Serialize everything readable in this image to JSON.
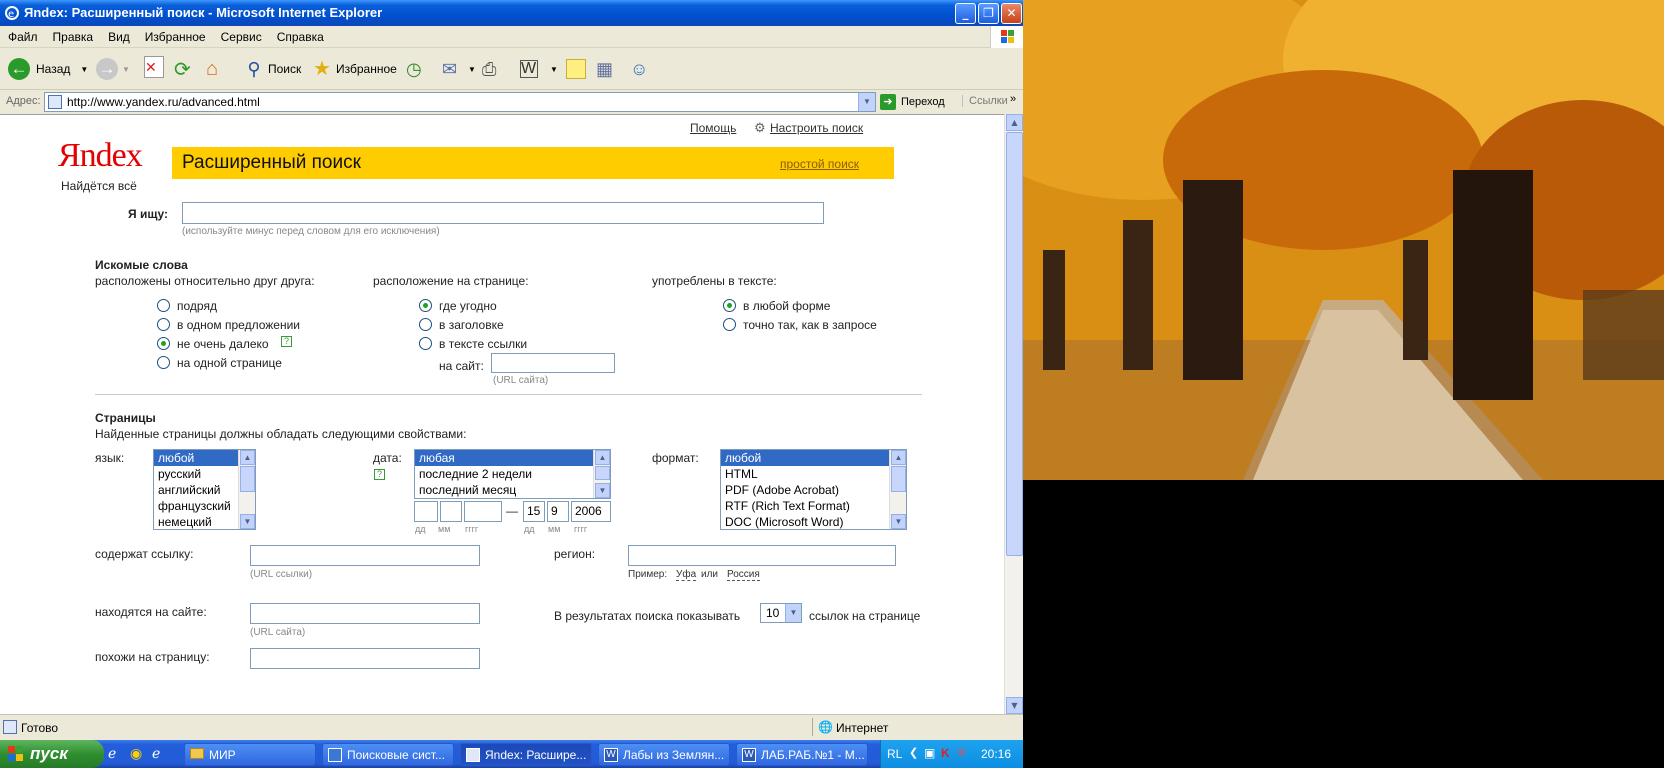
{
  "window": {
    "title": "Яndex: Расширенный поиск - Microsoft Internet Explorer",
    "min": "_",
    "max": "❐",
    "close": "✕"
  },
  "menu": [
    "Файл",
    "Правка",
    "Вид",
    "Избранное",
    "Сервис",
    "Справка"
  ],
  "toolbar": {
    "back": "Назад",
    "search": "Поиск",
    "favorites": "Избранное"
  },
  "address": {
    "label": "Адрес:",
    "url": "http://www.yandex.ru/advanced.html",
    "go": "Переход",
    "links": "Ссылки"
  },
  "page": {
    "logo": "Яndex",
    "slogan": "Найдётся всё",
    "help_link": "Помощь",
    "settings_link": "Настроить поиск",
    "header_title": "Расширенный поиск",
    "simple_search_link": "простой поиск",
    "query_label": "Я ищу:",
    "query_hint": "(используйте минус перед словом для его исключения)",
    "words_section": "Искомые слова",
    "relative_label": "расположены относительно друг друга:",
    "relative_options": [
      "подряд",
      "в одном предложении",
      "не очень далеко",
      "на одной странице"
    ],
    "position_label": "расположение на странице:",
    "position_options": [
      "где угодно",
      "в заголовке",
      "в тексте ссылки"
    ],
    "site_label": "на сайт:",
    "site_hint": "(URL сайта)",
    "form_label": "употреблены в тексте:",
    "form_options": [
      "в любой форме",
      "точно так, как в запросе"
    ],
    "pages_section": "Страницы",
    "pages_desc": "Найденные страницы должны обладать следующими свойствами:",
    "lang_label": "язык:",
    "lang_options": [
      "любой",
      "русский",
      "английский",
      "французский",
      "немецкий"
    ],
    "date_label": "дата:",
    "date_options": [
      "любая",
      "последние 2 недели",
      "последний месяц"
    ],
    "date_dash": "—",
    "date_to_day": "15",
    "date_to_month": "9",
    "date_to_year": "2006",
    "date_fmt": [
      "дд",
      "мм",
      "гггг"
    ],
    "format_label": "формат:",
    "format_options": [
      "любой",
      "HTML",
      "PDF (Adobe Acrobat)",
      "RTF (Rich Text Format)",
      "DOC (Microsoft Word)"
    ],
    "contains_link_label": "содержат ссылку:",
    "contains_link_hint": "(URL ссылки)",
    "region_label": "регион:",
    "region_example": "Пример:",
    "region_ex1": "Уфа",
    "region_or": "или",
    "region_ex2": "Россия",
    "on_site_label": "находятся на сайте:",
    "on_site_hint": "(URL сайта)",
    "results_prefix": "В результатах поиска показывать",
    "results_count": "10",
    "results_suffix": "ссылок на странице",
    "similar_label": "похожи на страницу:"
  },
  "status": {
    "text": "Готово",
    "zone": "Интернет"
  },
  "taskbar": {
    "start": "пуск",
    "tasks": [
      "МИР",
      "Поисковые сист...",
      "Яndex: Расшире...",
      "Лабы из Землян...",
      "ЛАБ.РАБ.№1 - М..."
    ],
    "lang": "RL",
    "time": "20:16"
  },
  "colors": {
    "accent_yellow": "#ffcc00",
    "logo_red": "#e30000",
    "xp_blue": "#0a5fd8"
  }
}
